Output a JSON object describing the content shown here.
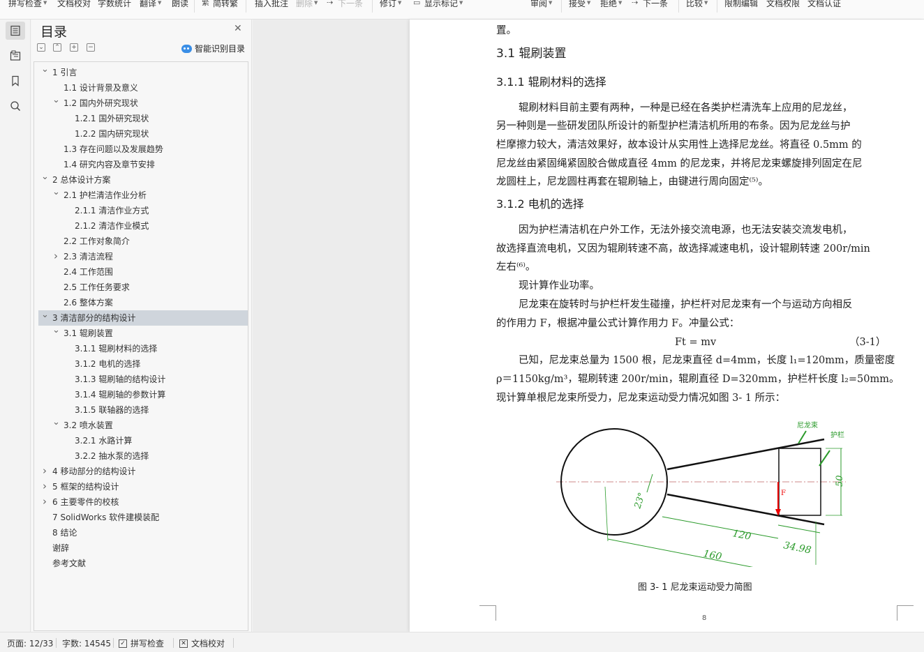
{
  "toolbar": {
    "items": [
      {
        "label": "拼写检查",
        "caret": true,
        "disabled": false
      },
      {
        "label": "文档校对",
        "caret": false,
        "disabled": false
      },
      {
        "label": "字数统计",
        "caret": false,
        "disabled": false
      },
      {
        "label": "翻译",
        "caret": true,
        "disabled": false
      },
      {
        "label": "朗读",
        "caret": false,
        "disabled": false
      },
      {
        "label": "简转繁",
        "caret": false,
        "disabled": false
      },
      {
        "label": "插入批注",
        "caret": false,
        "disabled": false
      },
      {
        "label": "删除",
        "caret": true,
        "disabled": true
      },
      {
        "label": "下一条",
        "caret": false,
        "disabled": true
      },
      {
        "label": "修订",
        "caret": true,
        "disabled": false
      },
      {
        "label": "显示标记",
        "caret": true,
        "disabled": false
      },
      {
        "label": "审阅",
        "caret": true,
        "disabled": false
      },
      {
        "label": "接受",
        "caret": true,
        "disabled": false
      },
      {
        "label": "拒绝",
        "caret": true,
        "disabled": false
      },
      {
        "label": "下一条",
        "caret": false,
        "disabled": false
      },
      {
        "label": "比较",
        "caret": true,
        "disabled": false
      },
      {
        "label": "限制编辑",
        "caret": false,
        "disabled": false
      },
      {
        "label": "文档权限",
        "caret": false,
        "disabled": false
      },
      {
        "label": "文档认证",
        "caret": false,
        "disabled": false
      }
    ]
  },
  "rail": {
    "icons": [
      "toc-icon",
      "outline-icon",
      "bookmark-icon",
      "search-icon"
    ]
  },
  "toc": {
    "title": "目录",
    "smart_label": "智能识别目录",
    "items": [
      {
        "label": "1 引言",
        "level": 1,
        "arrow": "down"
      },
      {
        "label": "1.1 设计背景及意义",
        "level": 2,
        "arrow": ""
      },
      {
        "label": "1.2 国内外研究现状",
        "level": 2,
        "arrow": "down"
      },
      {
        "label": "1.2.1 国外研究现状",
        "level": 3,
        "arrow": ""
      },
      {
        "label": "1.2.2 国内研究现状",
        "level": 3,
        "arrow": ""
      },
      {
        "label": "1.3 存在问题以及发展趋势",
        "level": 2,
        "arrow": ""
      },
      {
        "label": "1.4 研究内容及章节安排",
        "level": 2,
        "arrow": ""
      },
      {
        "label": "2 总体设计方案",
        "level": 1,
        "arrow": "down"
      },
      {
        "label": "2.1 护栏清洁作业分析",
        "level": 2,
        "arrow": "down"
      },
      {
        "label": "2.1.1 清洁作业方式",
        "level": 3,
        "arrow": ""
      },
      {
        "label": "2.1.2 清洁作业模式",
        "level": 3,
        "arrow": ""
      },
      {
        "label": "2.2 工作对象简介",
        "level": 2,
        "arrow": ""
      },
      {
        "label": "2.3 清洁流程",
        "level": 2,
        "arrow": "right"
      },
      {
        "label": "2.4 工作范围",
        "level": 2,
        "arrow": ""
      },
      {
        "label": "2.5 工作任务要求",
        "level": 2,
        "arrow": ""
      },
      {
        "label": "2.6 整体方案",
        "level": 2,
        "arrow": ""
      },
      {
        "label": "3 清洁部分的结构设计",
        "level": 1,
        "arrow": "down",
        "selected": true
      },
      {
        "label": "3.1 辊刷装置",
        "level": 2,
        "arrow": "down"
      },
      {
        "label": "3.1.1 辊刷材料的选择",
        "level": 3,
        "arrow": ""
      },
      {
        "label": "3.1.2 电机的选择",
        "level": 3,
        "arrow": ""
      },
      {
        "label": "3.1.3 辊刷轴的结构设计",
        "level": 3,
        "arrow": ""
      },
      {
        "label": "3.1.4 辊刷轴的参数计算",
        "level": 3,
        "arrow": ""
      },
      {
        "label": "3.1.5 联轴器的选择",
        "level": 3,
        "arrow": ""
      },
      {
        "label": "3.2 喷水装置",
        "level": 2,
        "arrow": "down"
      },
      {
        "label": "3.2.1 水路计算",
        "level": 3,
        "arrow": ""
      },
      {
        "label": "3.2.2 抽水泵的选择",
        "level": 3,
        "arrow": ""
      },
      {
        "label": "4 移动部分的结构设计",
        "level": 1,
        "arrow": "right"
      },
      {
        "label": "5 框架的结构设计",
        "level": 1,
        "arrow": "right"
      },
      {
        "label": "6 主要零件的校核",
        "level": 1,
        "arrow": "right"
      },
      {
        "label": "7 SolidWorks 软件建模装配",
        "level": 1,
        "arrow": ""
      },
      {
        "label": "8 结论",
        "level": 1,
        "arrow": ""
      },
      {
        "label": "谢辞",
        "level": 1,
        "arrow": ""
      },
      {
        "label": "参考文献",
        "level": 1,
        "arrow": ""
      }
    ]
  },
  "document": {
    "lines": [
      {
        "text": "置。",
        "kind": "body"
      },
      {
        "text": "3.1 辊刷装置",
        "kind": "h2"
      },
      {
        "text": "3.1.1 辊刷材料的选择",
        "kind": "h3"
      },
      {
        "text": "辊刷材料目前主要有两种，一种是已经在各类护栏清洗车上应用的尼龙丝，",
        "kind": "indent"
      },
      {
        "text": "另一种则是一些研发团队所设计的新型护栏清洁机所用的布条。因为尼龙丝与护",
        "kind": "body"
      },
      {
        "text": "栏摩擦力较大，清洁效果好，故本设计从实用性上选择尼龙丝。将直径 0.5mm 的",
        "kind": "body"
      },
      {
        "text": "尼龙丝由紧固绳紧固胶合做成直径 4mm 的尼龙束，并将尼龙束螺旋排列固定在尼",
        "kind": "body"
      },
      {
        "text": "龙圆柱上，尼龙圆柱再套在辊刷轴上，由键进行周向固定⁽⁵⁾。",
        "kind": "body"
      },
      {
        "text": "3.1.2 电机的选择",
        "kind": "h3"
      },
      {
        "text": "因为护栏清洁机在户外工作，无法外接交流电源，也无法安装交流发电机，",
        "kind": "indent"
      },
      {
        "text": "故选择直流电机，又因为辊刷转速不高，故选择减速电机，设计辊刷转速 200r/min",
        "kind": "body"
      },
      {
        "text": "左右⁽⁶⁾。",
        "kind": "body"
      },
      {
        "text": "现计算作业功率。",
        "kind": "indent"
      },
      {
        "text": "尼龙束在旋转时与护栏杆发生碰撞，护栏杆对尼龙束有一个与运动方向相反",
        "kind": "indent"
      },
      {
        "text": "的作用力 F，根据冲量公式计算作用力 F。冲量公式：",
        "kind": "body"
      },
      {
        "text": "已知，尼龙束总量为 1500 根，尼龙束直径 d=4mm，长度 l₁=120mm，质量密度",
        "kind": "indent"
      },
      {
        "text": "ρ＝1150kg/m³，辊刷转速 200r/min，辊刷直径 D=320mm，护栏杆长度 l₂=50mm。",
        "kind": "body"
      },
      {
        "text": "现计算单根尼龙束所受力，尼龙束运动受力情况如图 3- 1 所示：",
        "kind": "body"
      }
    ],
    "formula": "Ft = mv",
    "formula_no": "（3-1）",
    "figure": {
      "label_nylon": "尼龙束",
      "label_rail": "护栏",
      "label_force": "F",
      "angle": "23°",
      "dim_120": "120",
      "dim_160": "160",
      "dim_3498": "34.98",
      "dim_50": "50"
    },
    "caption": "图 3- 1   尼龙束运动受力简图",
    "page_number": "8"
  },
  "status": {
    "page": "页面: 12/33",
    "words": "字数: 14545",
    "spell": "拼写检查",
    "proof": "文档校对"
  }
}
